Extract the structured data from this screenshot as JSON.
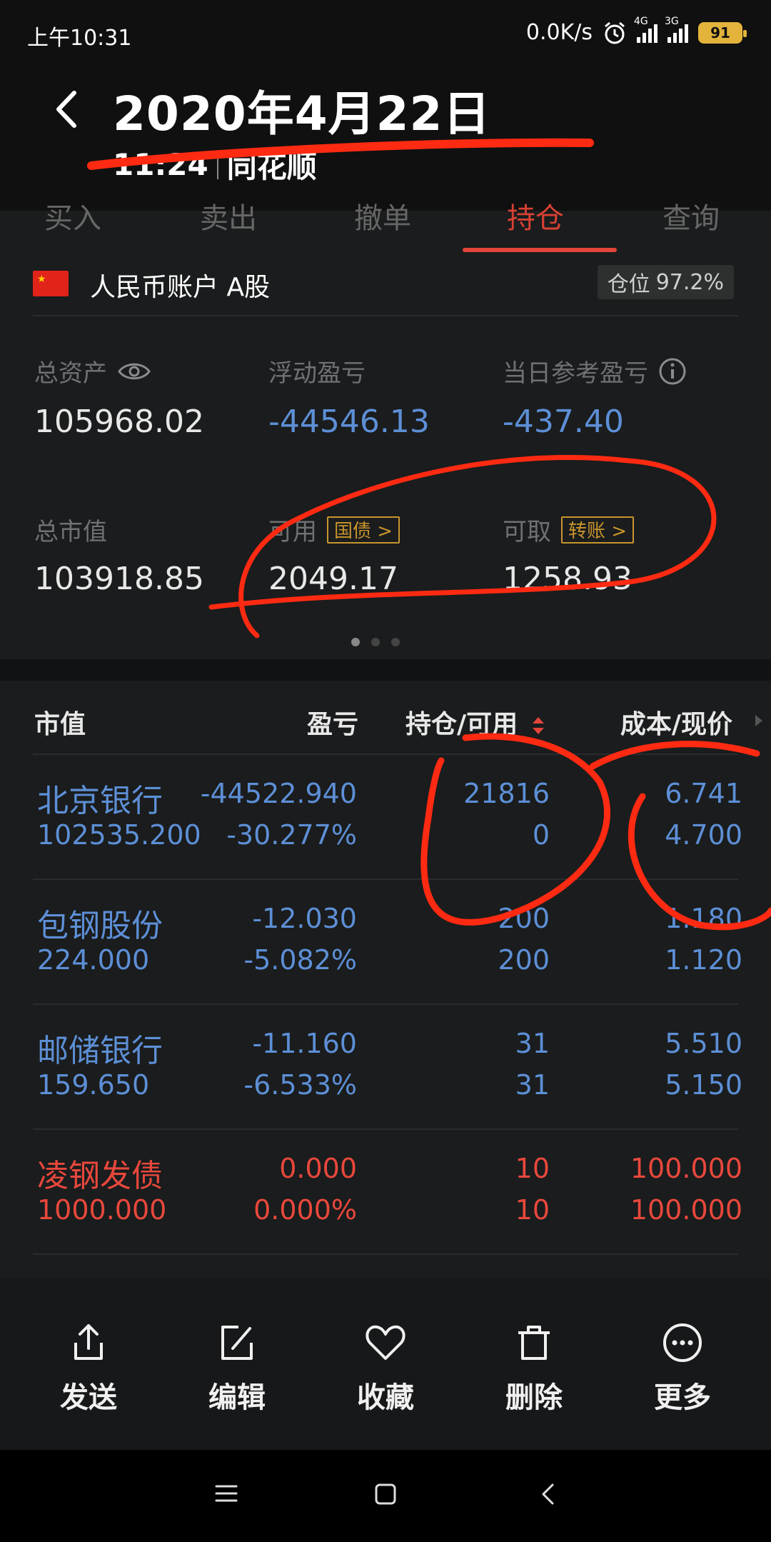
{
  "status_bar": {
    "time": "上午10:31",
    "net_speed": "0.0K/s",
    "signal1_tag": "4G",
    "signal2_tag": "3G",
    "battery": "91"
  },
  "header": {
    "date_title": "2020年4月22日",
    "sub_time": "11:24",
    "app_name": "同花顺"
  },
  "tabs": [
    "买入",
    "卖出",
    "撤单",
    "持仓",
    "查询"
  ],
  "account": {
    "label": "人民币账户 A股",
    "position_label": "仓位",
    "position_value": "97.2%"
  },
  "assets": {
    "total_assets_label": "总资产",
    "total_assets": "105968.02",
    "floating_pl_label": "浮动盈亏",
    "floating_pl": "-44546.13",
    "daily_pl_label": "当日参考盈亏",
    "daily_pl": "-437.40",
    "market_value_label": "总市值",
    "market_value": "103918.85",
    "available_label": "可用",
    "available_tag": "国债 >",
    "available": "2049.17",
    "withdrawable_label": "可取",
    "withdrawable_tag": "转账 >",
    "withdrawable": "1258.93"
  },
  "table": {
    "headers": [
      "市值",
      "盈亏",
      "持仓/可用",
      "成本/现价"
    ],
    "rows": [
      {
        "name": "北京银行",
        "market_value": "102535.200",
        "pl": "-44522.940",
        "pl_pct": "-30.277%",
        "holding": "21816",
        "available": "0",
        "cost": "6.741",
        "price": "4.700",
        "color": "blue"
      },
      {
        "name": "包钢股份",
        "market_value": "224.000",
        "pl": "-12.030",
        "pl_pct": "-5.082%",
        "holding": "200",
        "available": "200",
        "cost": "1.180",
        "price": "1.120",
        "color": "blue"
      },
      {
        "name": "邮储银行",
        "market_value": "159.650",
        "pl": "-11.160",
        "pl_pct": "-6.533%",
        "holding": "31",
        "available": "31",
        "cost": "5.510",
        "price": "5.150",
        "color": "blue"
      },
      {
        "name": "凌钢发债",
        "market_value": "1000.000",
        "pl": "0.000",
        "pl_pct": "0.000%",
        "holding": "10",
        "available": "10",
        "cost": "100.000",
        "price": "100.000",
        "color": "red"
      }
    ]
  },
  "actions": [
    {
      "label": "发送",
      "icon": "share-icon"
    },
    {
      "label": "编辑",
      "icon": "edit-icon"
    },
    {
      "label": "收藏",
      "icon": "heart-icon"
    },
    {
      "label": "删除",
      "icon": "trash-icon"
    },
    {
      "label": "更多",
      "icon": "more-icon"
    }
  ],
  "colors": {
    "accent_red": "#e4453a",
    "value_blue": "#5d8fd6",
    "tag_gold": "#c8952d"
  }
}
